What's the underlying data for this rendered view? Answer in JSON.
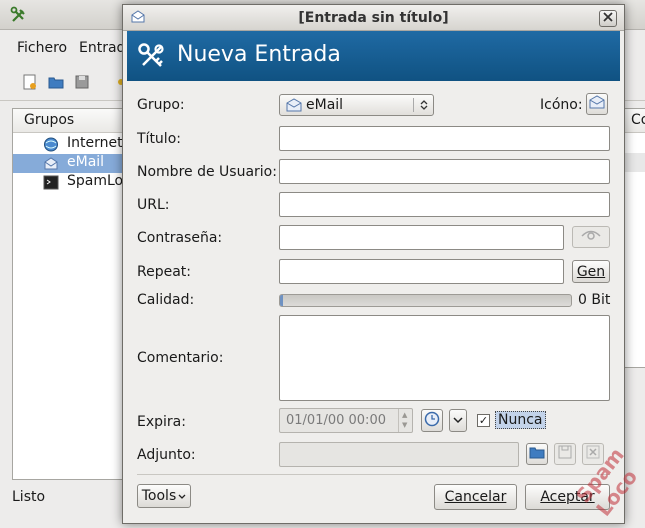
{
  "main_window": {
    "menu": [
      "Fichero",
      "Entrad"
    ],
    "groups_header": "Grupos",
    "groups": [
      {
        "label": "Internet",
        "icon": "globe-icon"
      },
      {
        "label": "eMail",
        "icon": "email-icon"
      },
      {
        "label": "SpamLo",
        "icon": "terminal-icon"
      }
    ],
    "right_column_header": "Co",
    "status": "Listo"
  },
  "dialog": {
    "title": "[Entrada sin título]",
    "banner_title": "Nueva Entrada",
    "labels": {
      "group": "Grupo:",
      "icon": "Icóno:",
      "title": "Título:",
      "username": "Nombre de Usuario:",
      "url": "URL:",
      "password": "Contraseña:",
      "repeat": "Repeat:",
      "quality": "Calidad:",
      "comment": "Comentario:",
      "expires": "Expira:",
      "attachment": "Adjunto:"
    },
    "group_select": {
      "value": "eMail",
      "icon": "email-icon"
    },
    "quality": {
      "value_fraction": 0.0,
      "text": "0 Bit"
    },
    "gen_button": "Gen",
    "expiry": {
      "value": "01/01/00 00:00",
      "never_checked": true,
      "never_label": "Nunca"
    },
    "buttons": {
      "tools": "Tools",
      "cancel": "Cancelar",
      "accept": "Aceptar"
    }
  },
  "colors": {
    "banner": "#105282",
    "selection": "#86abd9",
    "quality_fill": "#6f92c2"
  },
  "watermark_text": "SpamLoco"
}
